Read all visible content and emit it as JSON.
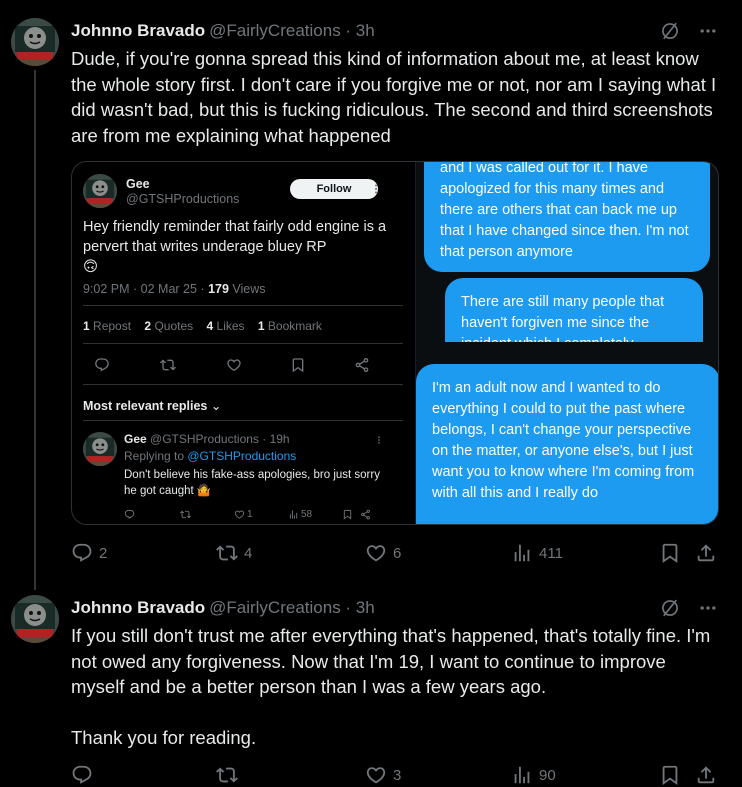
{
  "tweet1": {
    "author_name": "Johnno Bravado",
    "author_meta": "@FairlyCreations · 3h",
    "text": "Dude, if you're gonna spread this kind of information about me, at least know the whole story first. I don't care if you forgive me or not, nor am I saying what I did wasn't bad, but this is fucking ridiculous. The second and third screenshots are from me explaining what happened",
    "replies": "2",
    "reposts": "4",
    "likes": "6",
    "views": "411"
  },
  "screenshot_post": {
    "name": "Gee",
    "handle": "@GTSHProductions",
    "follow_label": "Follow",
    "text": "Hey friendly reminder that fairly odd engine is a pervert that writes underage bluey RP",
    "emoji": "🙃",
    "time": "9:02 PM · 02 Mar 25 · ",
    "views_count": "179",
    "views_label": " Views",
    "reposts_count": "1",
    "reposts_label": "Repost",
    "quotes_count": "2",
    "quotes_label": "Quotes",
    "likes_count": "4",
    "likes_label": "Likes",
    "bookmarks_count": "1",
    "bookmarks_label": "Bookmark",
    "replies_filter": "Most relevant replies",
    "reply": {
      "name": "Gee",
      "meta": "@GTSHProductions · 19h",
      "replying_prefix": "Replying to ",
      "replying_to": "@GTSHProductions",
      "text": "Don't believe his fake-ass apologies, bro just sorry he got caught 🤷",
      "likes": "1",
      "views": "58"
    }
  },
  "chat_bubbles": [
    "and I was called out for it. I have apologized for this many times and there are others that can back me up that I have changed since then. I'm not that person anymore",
    "There are still many people that haven't forgiven me since the incident which I completely",
    "I'm an adult now and I wanted to do everything I could to put the past where belongs, I can't change your perspective on the matter, or anyone else's, but I just want you to know where I'm coming from with all this and I really do"
  ],
  "tweet2": {
    "author_name": "Johnno Bravado",
    "author_meta": "@FairlyCreations · 3h",
    "text_p1": "If you still don't trust me after everything that's happened, that's totally fine. I'm not owed any forgiveness. Now that I'm 19, I want to continue to improve myself and be a better person than I was a few years ago.",
    "text_p2": "Thank you for reading.",
    "replies": "",
    "reposts": "",
    "likes": "3",
    "views": "90"
  },
  "colors": {
    "background": "#000000",
    "text": "#e7e9ea",
    "muted": "#71767b",
    "accent": "#1d9bf0",
    "divider": "#2f3336"
  }
}
